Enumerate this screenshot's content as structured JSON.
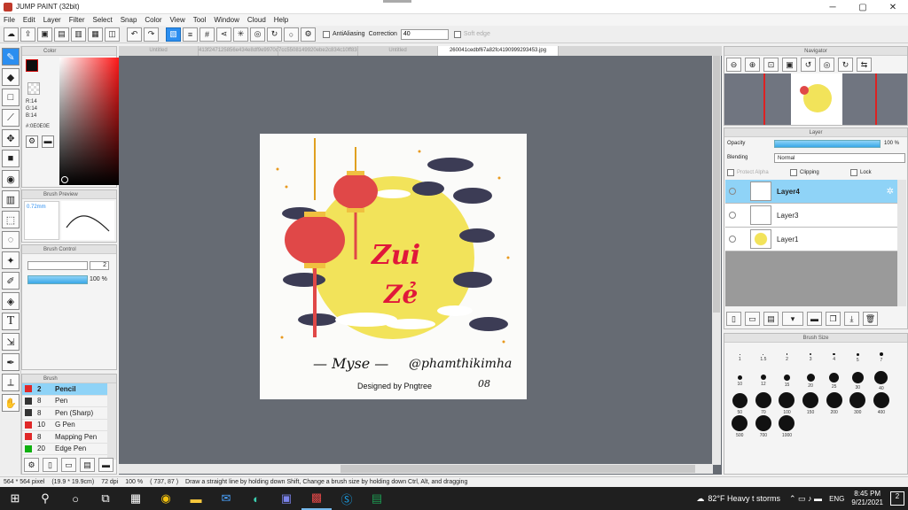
{
  "app": {
    "title": "JUMP PAINT (32bit)",
    "window_buttons": [
      "─",
      "▢",
      "✕"
    ]
  },
  "menu": [
    "File",
    "Edit",
    "Layer",
    "Filter",
    "Select",
    "Snap",
    "Color",
    "View",
    "Tool",
    "Window",
    "Cloud",
    "Help"
  ],
  "toolbar": {
    "antialiasing": "AntiAliasing",
    "correction_label": "Correction",
    "correction_value": "40",
    "soft_edge": "Soft edge"
  },
  "tabs": [
    "Untitled",
    "413f247125856e434e8df9e9970c7cc6.jpg",
    "7cc5508149920ebe2c834c10ff83cbbe.jpg",
    "Untitled",
    "260041cedbf67a82fc4190999293453.jpg"
  ],
  "color_panel": {
    "title": "Color",
    "r": "R:14",
    "g": "G:14",
    "b": "B:14",
    "hex": "#:0E0E0E"
  },
  "brush_preview": {
    "title": "Brush Preview",
    "size": "0.72mm"
  },
  "brush_control": {
    "title": "Brush Control",
    "size": "2",
    "opacity": "100 %"
  },
  "brush_panel": {
    "title": "Brush",
    "items": [
      {
        "num": "2",
        "name": "Pencil",
        "color": "red"
      },
      {
        "num": "8",
        "name": "Pen",
        "color": "dark"
      },
      {
        "num": "8",
        "name": "Pen (Sharp)",
        "color": "dark"
      },
      {
        "num": "10",
        "name": "G Pen",
        "color": "red"
      },
      {
        "num": "8",
        "name": "Mapping Pen",
        "color": "red"
      },
      {
        "num": "20",
        "name": "Edge Pen",
        "color": "green"
      }
    ]
  },
  "navigator": {
    "title": "Navigator"
  },
  "layer_panel": {
    "title": "Layer",
    "opacity_label": "Opacity",
    "opacity": "100 %",
    "blending_label": "Blending",
    "blending": "Normal",
    "protect_alpha": "Protect Alpha",
    "clipping": "Clipping",
    "lock": "Lock",
    "layers": [
      {
        "name": "Layer4",
        "selected": true
      },
      {
        "name": "Layer3",
        "selected": false
      },
      {
        "name": "Layer1",
        "selected": false
      }
    ]
  },
  "brush_size": {
    "title": "Brush Size",
    "sizes": [
      "1",
      "1.5",
      "2",
      "3",
      "4",
      "5",
      "7",
      "10",
      "12",
      "15",
      "20",
      "25",
      "30",
      "40",
      "50",
      "70",
      "100",
      "150",
      "200",
      "300",
      "400",
      "500",
      "700",
      "1000"
    ]
  },
  "artwork": {
    "title_line1": "Zui",
    "title_line2": "Zẻ",
    "signature": "Myse",
    "handle": "@phamthikimha",
    "number": "08",
    "credit": "Designed by Pngtree"
  },
  "status": {
    "size": "564 * 564 pixel",
    "dims": "(19.9 * 19.9cm)",
    "dpi": "72 dpi",
    "zoom": "100 %",
    "coords": "( 737, 87 )",
    "hint": "Draw a straight line by holding down Shift, Change a brush size by holding down Ctrl, Alt, and dragging"
  },
  "taskbar": {
    "weather": "82°F  Heavy t storms",
    "lang": "ENG",
    "time": "8:45 PM",
    "date": "9/21/2021",
    "notif": "2"
  }
}
